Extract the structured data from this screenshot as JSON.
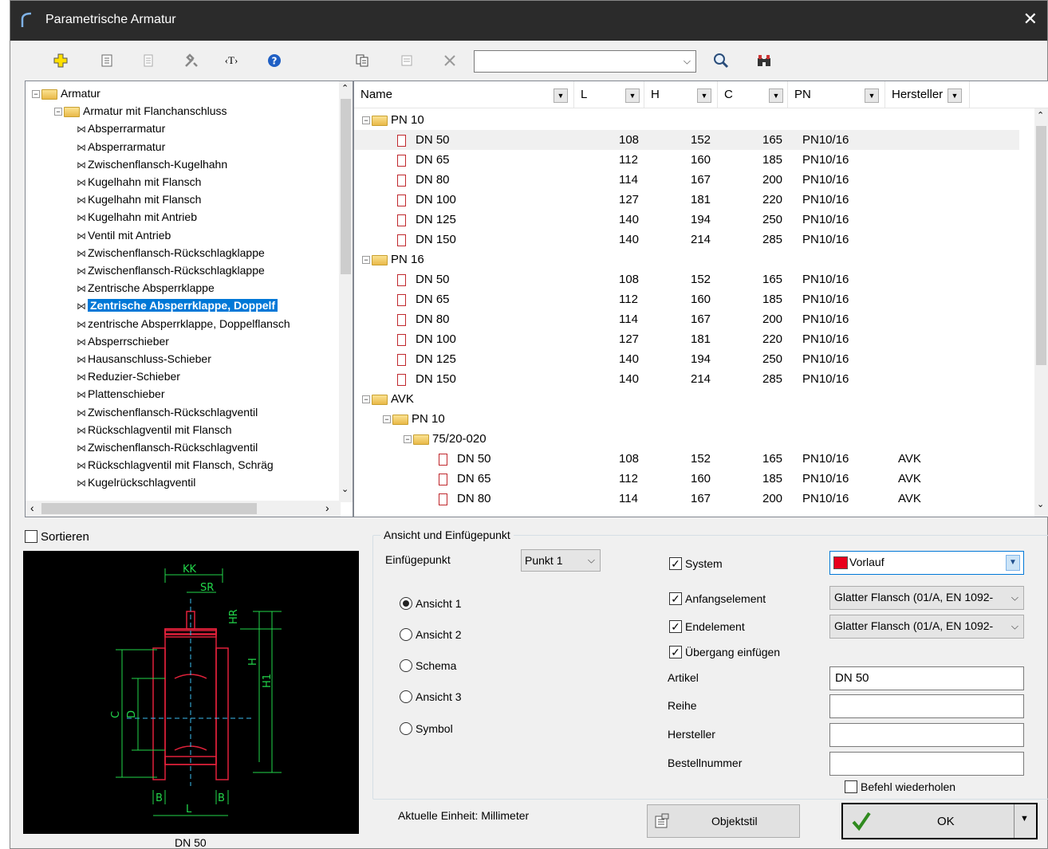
{
  "window": {
    "title": "Parametrische Armatur",
    "close_glyph": "✕"
  },
  "toolbar": {
    "search_value": ""
  },
  "tree": [
    {
      "label": "Armatur",
      "level": 0,
      "type": "folder",
      "expander": "−"
    },
    {
      "label": "Armatur mit Flanchanschluss",
      "level": 1,
      "type": "folder",
      "expander": "−"
    },
    {
      "label": "Absperrarmatur",
      "level": 2,
      "type": "item"
    },
    {
      "label": "Absperrarmatur",
      "level": 2,
      "type": "item"
    },
    {
      "label": "Zwischenflansch-Kugelhahn",
      "level": 2,
      "type": "item"
    },
    {
      "label": "Kugelhahn mit Flansch",
      "level": 2,
      "type": "item"
    },
    {
      "label": "Kugelhahn mit Flansch",
      "level": 2,
      "type": "item"
    },
    {
      "label": "Kugelhahn mit Antrieb",
      "level": 2,
      "type": "item"
    },
    {
      "label": "Ventil mit Antrieb",
      "level": 2,
      "type": "item"
    },
    {
      "label": "Zwischenflansch-Rückschlagklappe",
      "level": 2,
      "type": "item"
    },
    {
      "label": "Zwischenflansch-Rückschlagklappe",
      "level": 2,
      "type": "item"
    },
    {
      "label": "Zentrische Absperrklappe",
      "level": 2,
      "type": "item"
    },
    {
      "label": "Zentrische Absperrklappe, Doppelf",
      "level": 2,
      "type": "item",
      "selected": true
    },
    {
      "label": "zentrische Absperrklappe, Doppelflansch",
      "level": 2,
      "type": "item"
    },
    {
      "label": "Absperrschieber",
      "level": 2,
      "type": "item"
    },
    {
      "label": "Hausanschluss-Schieber",
      "level": 2,
      "type": "item"
    },
    {
      "label": "Reduzier-Schieber",
      "level": 2,
      "type": "item"
    },
    {
      "label": "Plattenschieber",
      "level": 2,
      "type": "item"
    },
    {
      "label": "Zwischenflansch-Rückschlagventil",
      "level": 2,
      "type": "item"
    },
    {
      "label": "Rückschlagventil mit Flansch",
      "level": 2,
      "type": "item"
    },
    {
      "label": "Zwischenflansch-Rückschlagventil",
      "level": 2,
      "type": "item"
    },
    {
      "label": "Rückschlagventil mit Flansch, Schräg",
      "level": 2,
      "type": "item"
    },
    {
      "label": "Kugelrückschlagventil",
      "level": 2,
      "type": "item"
    }
  ],
  "grid": {
    "columns": [
      "Name",
      "L",
      "H",
      "C",
      "PN",
      "Hersteller"
    ],
    "rows": [
      {
        "level": 0,
        "kind": "group",
        "name": "PN 10"
      },
      {
        "level": 1,
        "kind": "item",
        "name": "DN 50",
        "L": "108",
        "H": "152",
        "C": "165",
        "PN": "PN10/16",
        "hersteller": "",
        "highlight": true
      },
      {
        "level": 1,
        "kind": "item",
        "name": "DN 65",
        "L": "112",
        "H": "160",
        "C": "185",
        "PN": "PN10/16",
        "hersteller": ""
      },
      {
        "level": 1,
        "kind": "item",
        "name": "DN 80",
        "L": "114",
        "H": "167",
        "C": "200",
        "PN": "PN10/16",
        "hersteller": ""
      },
      {
        "level": 1,
        "kind": "item",
        "name": "DN 100",
        "L": "127",
        "H": "181",
        "C": "220",
        "PN": "PN10/16",
        "hersteller": ""
      },
      {
        "level": 1,
        "kind": "item",
        "name": "DN 125",
        "L": "140",
        "H": "194",
        "C": "250",
        "PN": "PN10/16",
        "hersteller": ""
      },
      {
        "level": 1,
        "kind": "item",
        "name": "DN 150",
        "L": "140",
        "H": "214",
        "C": "285",
        "PN": "PN10/16",
        "hersteller": ""
      },
      {
        "level": 0,
        "kind": "group",
        "name": "PN 16"
      },
      {
        "level": 1,
        "kind": "item",
        "name": "DN 50",
        "L": "108",
        "H": "152",
        "C": "165",
        "PN": "PN10/16",
        "hersteller": ""
      },
      {
        "level": 1,
        "kind": "item",
        "name": "DN 65",
        "L": "112",
        "H": "160",
        "C": "185",
        "PN": "PN10/16",
        "hersteller": ""
      },
      {
        "level": 1,
        "kind": "item",
        "name": "DN 80",
        "L": "114",
        "H": "167",
        "C": "200",
        "PN": "PN10/16",
        "hersteller": ""
      },
      {
        "level": 1,
        "kind": "item",
        "name": "DN 100",
        "L": "127",
        "H": "181",
        "C": "220",
        "PN": "PN10/16",
        "hersteller": ""
      },
      {
        "level": 1,
        "kind": "item",
        "name": "DN 125",
        "L": "140",
        "H": "194",
        "C": "250",
        "PN": "PN10/16",
        "hersteller": ""
      },
      {
        "level": 1,
        "kind": "item",
        "name": "DN 150",
        "L": "140",
        "H": "214",
        "C": "285",
        "PN": "PN10/16",
        "hersteller": ""
      },
      {
        "level": 0,
        "kind": "group",
        "name": "AVK"
      },
      {
        "level": 1,
        "kind": "group",
        "name": "PN 10"
      },
      {
        "level": 2,
        "kind": "group",
        "name": "75/20-020"
      },
      {
        "level": 3,
        "kind": "item",
        "name": "DN 50",
        "L": "108",
        "H": "152",
        "C": "165",
        "PN": "PN10/16",
        "hersteller": "AVK"
      },
      {
        "level": 3,
        "kind": "item",
        "name": "DN 65",
        "L": "112",
        "H": "160",
        "C": "185",
        "PN": "PN10/16",
        "hersteller": "AVK"
      },
      {
        "level": 3,
        "kind": "item",
        "name": "DN 80",
        "L": "114",
        "H": "167",
        "C": "200",
        "PN": "PN10/16",
        "hersteller": "AVK"
      }
    ]
  },
  "sort_label": "Sortieren",
  "preview": {
    "caption": "DN 50",
    "dims": [
      "KK",
      "SR",
      "HR",
      "H",
      "H1",
      "C",
      "D",
      "B",
      "B",
      "L"
    ]
  },
  "group_title": "Ansicht und Einfügepunkt",
  "insert": {
    "label": "Einfügepunkt",
    "value": "Punkt 1"
  },
  "views": [
    "Ansicht 1",
    "Ansicht 2",
    "Schema",
    "Ansicht 3",
    "Symbol"
  ],
  "selected_view": 0,
  "system": {
    "label": "System",
    "checked": true,
    "value": "Vorlauf",
    "color": "#e8001c"
  },
  "start_element": {
    "label": "Anfangselement",
    "checked": true,
    "value": "Glatter Flansch (01/A, EN 1092-"
  },
  "end_element": {
    "label": "Endelement",
    "checked": true,
    "value": "Glatter Flansch (01/A, EN 1092-"
  },
  "transition": {
    "label": "Übergang einfügen",
    "checked": true
  },
  "fields": [
    {
      "label": "Artikel",
      "value": "DN 50"
    },
    {
      "label": "Reihe",
      "value": ""
    },
    {
      "label": "Hersteller",
      "value": ""
    },
    {
      "label": "Bestellnummer",
      "value": ""
    }
  ],
  "repeat": {
    "label": "Befehl wiederholen",
    "checked": false
  },
  "unit_text": "Aktuelle Einheit: Millimeter",
  "buttons": {
    "objektstil": "Objektstil",
    "ok": "OK"
  }
}
